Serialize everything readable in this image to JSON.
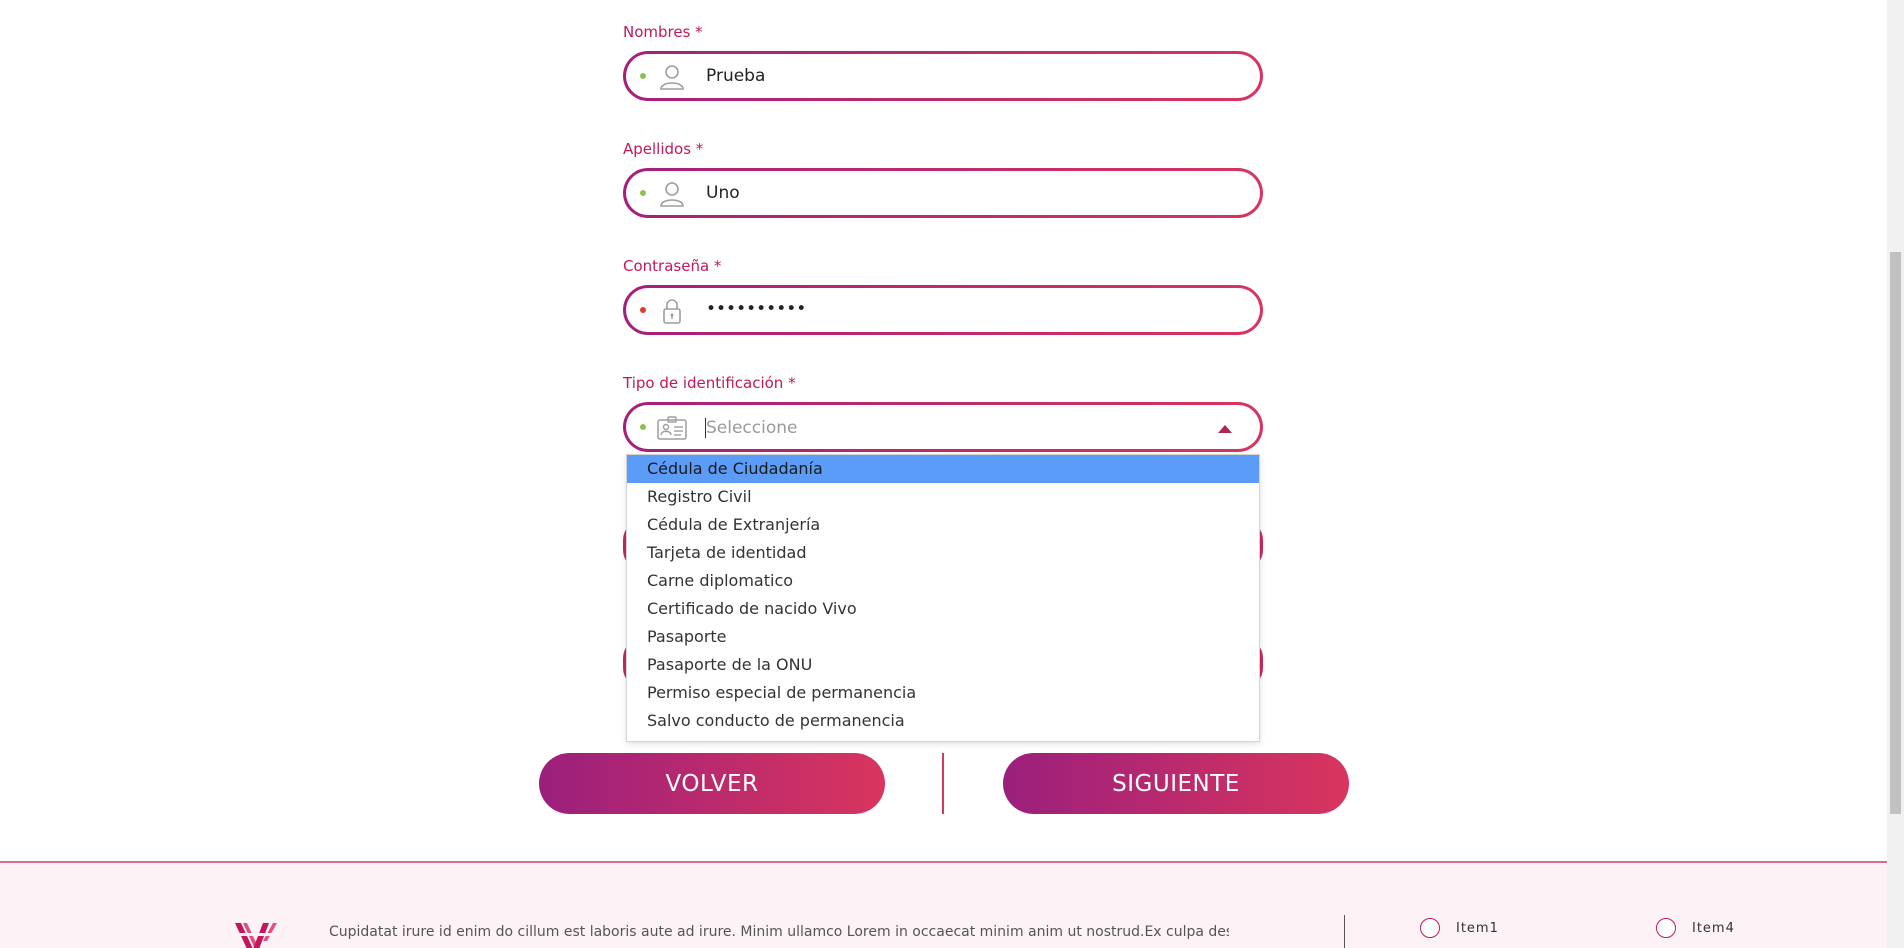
{
  "form": {
    "nombres": {
      "label": "Nombres *",
      "value": "Prueba"
    },
    "apellidos": {
      "label": "Apellidos *",
      "value": "Uno"
    },
    "contrasena": {
      "label": "Contraseña *",
      "value": "••••••••••"
    },
    "tipo_identificacion": {
      "label": "Tipo de identificación *",
      "placeholder": "Seleccione",
      "options": [
        "Cédula de Ciudadanía",
        "Registro Civil",
        "Cédula de Extranjería",
        "Tarjeta de identidad",
        "Carne diplomatico",
        "Certificado de nacido Vivo",
        "Pasaporte",
        "Pasaporte de la ONU",
        "Permiso especial de permanencia",
        "Salvo conducto de permanencia"
      ],
      "highlighted_option": "Cédula de Ciudadanía"
    }
  },
  "buttons": {
    "back": "VOLVER",
    "next": "SIGUIENTE"
  },
  "footer": {
    "text": "Cupidatat irure id enim do cillum est laboris aute ad irure. Minim ullamco Lorem in occaecat minim anim ut nostrud.Ex culpa deserunt do fugiat",
    "items": [
      "Item1",
      "Item4"
    ]
  },
  "colors": {
    "accent_start": "#9b1f7c",
    "accent_end": "#d9355e",
    "label": "#c2185b",
    "valid_dot": "#8bc34a",
    "invalid_dot": "#e53935",
    "highlight": "#5b9cf8"
  },
  "icons": {
    "nombres": "user-icon",
    "apellidos": "user-icon",
    "contrasena": "lock-icon",
    "tipo_identificacion": "id-card-icon",
    "dropdown": "chevron-up-icon"
  }
}
